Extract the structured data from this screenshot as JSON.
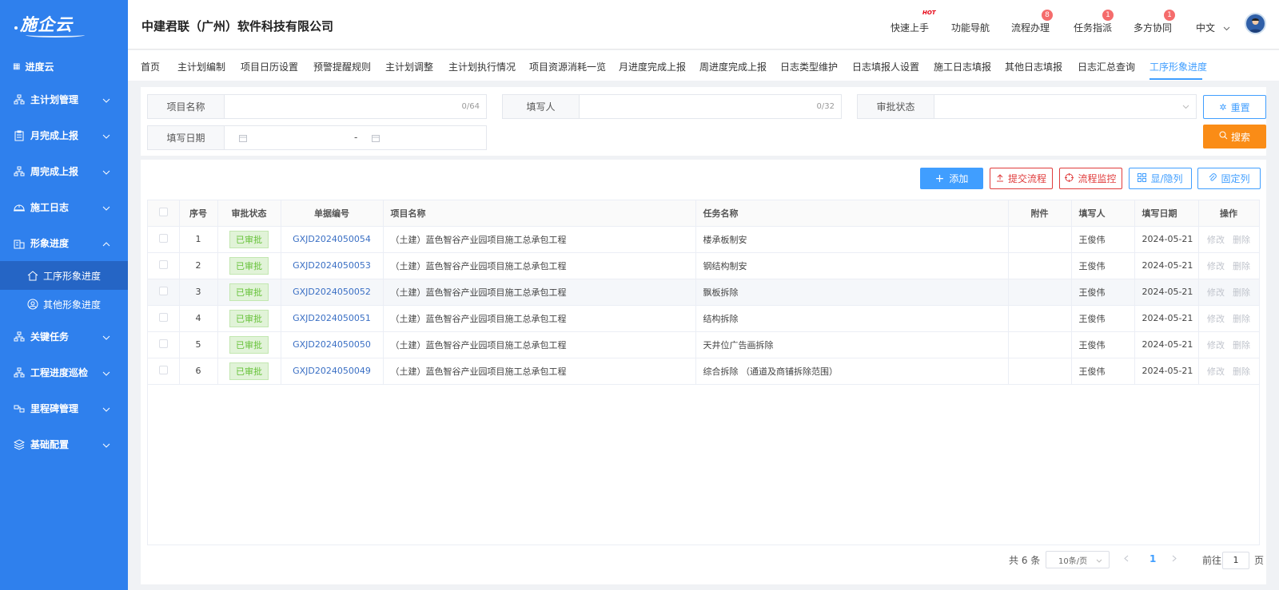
{
  "brand": {
    "logo_text": "施企云"
  },
  "sidebar": {
    "top": "进度云",
    "items": [
      {
        "label": "主计划管理"
      },
      {
        "label": "月完成上报"
      },
      {
        "label": "周完成上报"
      },
      {
        "label": "施工日志"
      },
      {
        "label": "形象进度"
      }
    ],
    "sub_items": [
      {
        "label": "工序形象进度"
      },
      {
        "label": "其他形象进度"
      }
    ],
    "items_after": [
      {
        "label": "关键任务"
      },
      {
        "label": "工程进度巡检"
      },
      {
        "label": "里程碑管理"
      },
      {
        "label": "基础配置"
      }
    ]
  },
  "header": {
    "company": "中建君联（广州）软件科技有限公司",
    "menu": [
      {
        "label": "快速上手",
        "hot": "HOT"
      },
      {
        "label": "功能导航"
      },
      {
        "label": "流程办理",
        "badge": "8"
      },
      {
        "label": "任务指派",
        "badge": "1"
      },
      {
        "label": "多方协同",
        "badge": "1"
      }
    ],
    "language": "中文"
  },
  "tabs": [
    "首页",
    "主计划编制",
    "项目日历设置",
    "预警提醒规则",
    "主计划调整",
    "主计划执行情况",
    "项目资源消耗一览",
    "月进度完成上报",
    "周进度完成上报",
    "日志类型维护",
    "日志填报人设置",
    "施工日志填报",
    "其他日志填报",
    "日志汇总查询",
    "工序形象进度"
  ],
  "filter": {
    "project_name_label": "项目名称",
    "project_name_count": "0/64",
    "filler_label": "填写人",
    "filler_count": "0/32",
    "status_label": "审批状态",
    "date_label": "填写日期",
    "date_sep": "-",
    "reset_label": "重置",
    "search_label": "搜索"
  },
  "actions": {
    "add": "添加",
    "submit_flow": "提交流程",
    "monitor_flow": "流程监控",
    "toggle_columns": "显/隐列",
    "fix_columns": "固定列"
  },
  "table": {
    "columns": [
      "序号",
      "审批状态",
      "单据编号",
      "项目名称",
      "任务名称",
      "附件",
      "填写人",
      "填写日期",
      "操作"
    ],
    "rows": [
      {
        "no": "1",
        "status": "已审批",
        "code": "GXJD2024050054",
        "project": "（土建）蓝色智谷产业园项目施工总承包工程",
        "task": "楼承板制安",
        "attach": "",
        "filler": "王俊伟",
        "date": "2024-05-21"
      },
      {
        "no": "2",
        "status": "已审批",
        "code": "GXJD2024050053",
        "project": "（土建）蓝色智谷产业园项目施工总承包工程",
        "task": "钢结构制安",
        "attach": "",
        "filler": "王俊伟",
        "date": "2024-05-21"
      },
      {
        "no": "3",
        "status": "已审批",
        "code": "GXJD2024050052",
        "project": "（土建）蓝色智谷产业园项目施工总承包工程",
        "task": "飘板拆除",
        "attach": "",
        "filler": "王俊伟",
        "date": "2024-05-21"
      },
      {
        "no": "4",
        "status": "已审批",
        "code": "GXJD2024050051",
        "project": "（土建）蓝色智谷产业园项目施工总承包工程",
        "task": "结构拆除",
        "attach": "",
        "filler": "王俊伟",
        "date": "2024-05-21"
      },
      {
        "no": "5",
        "status": "已审批",
        "code": "GXJD2024050050",
        "project": "（土建）蓝色智谷产业园项目施工总承包工程",
        "task": "天井位广告画拆除",
        "attach": "",
        "filler": "王俊伟",
        "date": "2024-05-21"
      },
      {
        "no": "6",
        "status": "已审批",
        "code": "GXJD2024050049",
        "project": "（土建）蓝色智谷产业园项目施工总承包工程",
        "task": "综合拆除 （通道及商铺拆除范围）",
        "attach": "",
        "filler": "王俊伟",
        "date": "2024-05-21"
      }
    ],
    "op_edit": "修改",
    "op_delete": "删除"
  },
  "pagination": {
    "total": "共 6 条",
    "page_size": "10条/页",
    "current_page": "1",
    "goto_label": "前往",
    "goto_value": "1",
    "page_suffix": "页"
  },
  "colors": {
    "sidebar": "#2f80ed",
    "accent": "#409eff",
    "search": "#fa8c16",
    "danger": "#e03c3c"
  }
}
